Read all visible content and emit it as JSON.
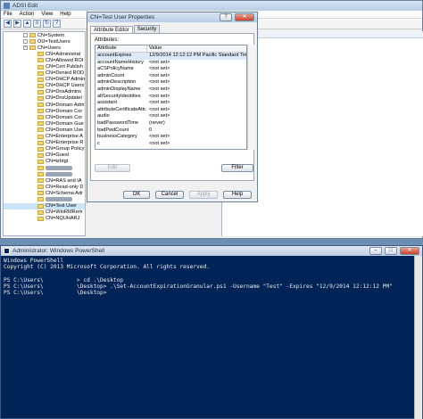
{
  "adsi": {
    "title": "ADSI Edit",
    "menu": [
      "File",
      "Action",
      "View",
      "Help"
    ],
    "toolbar_icons": [
      "back-arrow-icon",
      "forward-arrow-icon",
      "up-folder-icon",
      "properties-icon",
      "refresh-icon",
      "help-icon"
    ],
    "tree": [
      {
        "label": "CN=System",
        "indent": 1,
        "expander": ""
      },
      {
        "label": "OU=TestUsers",
        "indent": 1,
        "expander": ""
      },
      {
        "label": "CN=Users",
        "indent": 1,
        "expander": "-"
      },
      {
        "label": "CN=Administrat",
        "indent": 2
      },
      {
        "label": "CN=Allowed ROI",
        "indent": 2
      },
      {
        "label": "CN=Cert Publish",
        "indent": 2
      },
      {
        "label": "CN=Denied ROD",
        "indent": 2
      },
      {
        "label": "CN=DHCP Admin",
        "indent": 2
      },
      {
        "label": "CN=DHCP Users",
        "indent": 2
      },
      {
        "label": "CN=DnsAdmins",
        "indent": 2
      },
      {
        "label": "CN=DnsUpdateI",
        "indent": 2
      },
      {
        "label": "CN=Domain Adm",
        "indent": 2
      },
      {
        "label": "CN=Domain Cor",
        "indent": 2
      },
      {
        "label": "CN=Domain Cor",
        "indent": 2
      },
      {
        "label": "CN=Domain Gue",
        "indent": 2
      },
      {
        "label": "CN=Domain Use",
        "indent": 2
      },
      {
        "label": "CN=Enterprise A",
        "indent": 2
      },
      {
        "label": "CN=Enterprise R",
        "indent": 2
      },
      {
        "label": "CN=Group Policy",
        "indent": 2
      },
      {
        "label": "CN=Guest",
        "indent": 2
      },
      {
        "label": "CN=krbtgt",
        "indent": 2
      },
      {
        "label": "",
        "indent": 2,
        "redacted": true
      },
      {
        "label": "",
        "indent": 2,
        "redacted": true
      },
      {
        "label": "CN=RAS and IA",
        "indent": 2
      },
      {
        "label": "CN=Read-only D",
        "indent": 2
      },
      {
        "label": "CN=Schema Adr",
        "indent": 2
      },
      {
        "label": "",
        "indent": 2,
        "redacted": true
      },
      {
        "label": "CN=Test User",
        "indent": 2,
        "selected": true
      },
      {
        "label": "CN=WinRMRem",
        "indent": 2
      },
      {
        "label": "CN=NQUHARJ",
        "indent": 2
      }
    ]
  },
  "dialog": {
    "title": "CN=Test User Properties",
    "help_glyph": "?",
    "tabs": [
      "Attribute Editor",
      "Security"
    ],
    "attributes_label": "Attributes:",
    "columns": [
      "Attribute",
      "Value"
    ],
    "rows": [
      {
        "attr": "accountExpires",
        "value": "12/9/2014 12:12:12 PM Pacific Standard Tim",
        "selected": true
      },
      {
        "attr": "accountNameHistory",
        "value": "<not set>"
      },
      {
        "attr": "aCSPolicyName",
        "value": "<not set>"
      },
      {
        "attr": "adminCount",
        "value": "<not set>"
      },
      {
        "attr": "adminDescription",
        "value": "<not set>"
      },
      {
        "attr": "adminDisplayName",
        "value": "<not set>"
      },
      {
        "attr": "altSecurityIdentities",
        "value": "<not set>"
      },
      {
        "attr": "assistant",
        "value": "<not set>"
      },
      {
        "attr": "attributeCertificateAttr...",
        "value": "<not set>"
      },
      {
        "attr": "audio",
        "value": "<not set>"
      },
      {
        "attr": "badPasswordTime",
        "value": "(never)"
      },
      {
        "attr": "badPwdCount",
        "value": "0"
      },
      {
        "attr": "businessCategory",
        "value": "<not set>"
      },
      {
        "attr": "c",
        "value": "<not set>"
      }
    ],
    "edit_button": "Edit",
    "filter_button": "Filter",
    "ok_button": "OK",
    "cancel_button": "Cancel",
    "apply_button": "Apply",
    "help_button": "Help"
  },
  "powershell": {
    "title": "Administrator: Windows PowerShell",
    "lines": [
      "Windows PowerShell",
      "Copyright (C) 2013 Microsoft Corporation. All rights reserved.",
      "",
      "PS C:\\Users\\          > cd .\\Desktop",
      "PS C:\\Users\\          \\Desktop> .\\Set-AccountExpirationGranular.ps1 -Username \"Test\" -Expires \"12/9/2014 12:12:12 PM\"",
      "PS C:\\Users\\          \\Desktop>"
    ]
  }
}
